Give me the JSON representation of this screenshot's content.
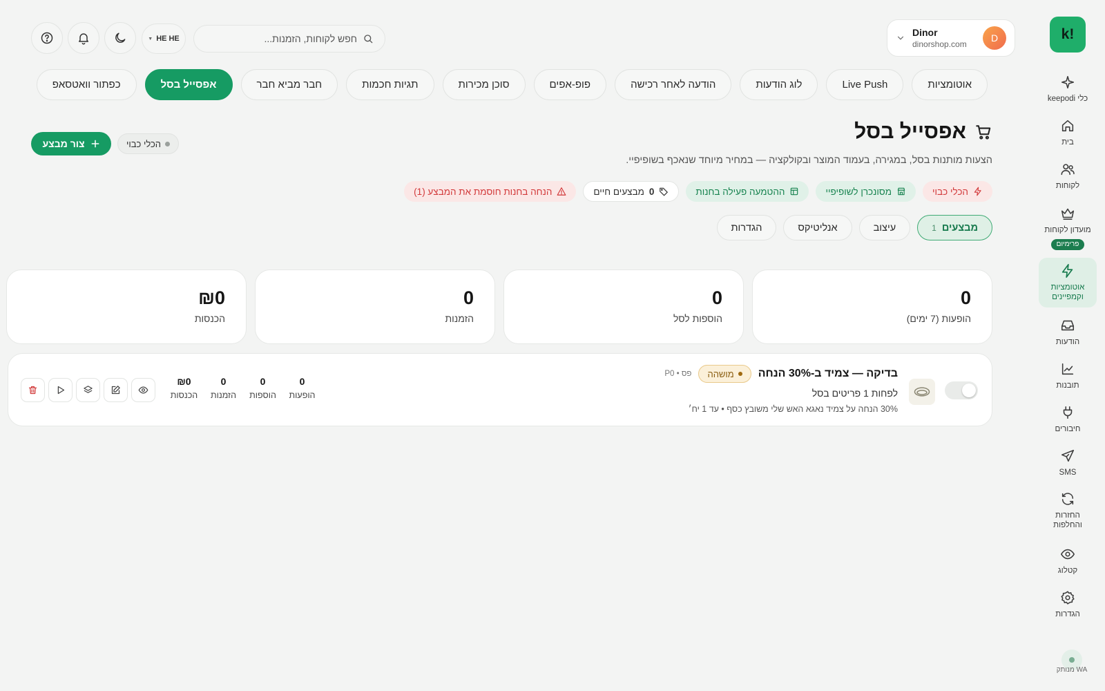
{
  "sidebar": {
    "logo_text": "!k",
    "items": [
      {
        "label": "כלי keepodi",
        "icon": "sparkle-icon"
      },
      {
        "label": "בית",
        "icon": "home-icon"
      },
      {
        "label": "לקוחות",
        "icon": "users-icon"
      },
      {
        "label": "מועדון לקוחות",
        "icon": "crown-icon",
        "badge": "פרימיום"
      },
      {
        "label": "אוטומציות וקמפיינים",
        "icon": "bolt-icon",
        "active": true
      },
      {
        "label": "הודעות",
        "icon": "inbox-icon"
      },
      {
        "label": "תובנות",
        "icon": "chart-icon"
      },
      {
        "label": "חיבורים",
        "icon": "plug-icon"
      },
      {
        "label": "SMS",
        "icon": "send-icon"
      },
      {
        "label": "החזרות והחלפות",
        "icon": "refresh-icon"
      },
      {
        "label": "קטלוג",
        "icon": "eye-icon"
      },
      {
        "label": "הגדרות",
        "icon": "gear-icon"
      }
    ],
    "wa_status": "WA מנותק"
  },
  "header": {
    "store_name": "Dinor",
    "store_domain": "dinorshop.com",
    "avatar_letter": "D",
    "search_placeholder": "חפש לקוחות, הזמנות...",
    "lang_label": "HE"
  },
  "feature_tabs": [
    "אוטומציות",
    "Live Push",
    "לוג הודעות",
    "הודעה לאחר רכישה",
    "פופ-אפים",
    "סוכן מכירות",
    "תגיות חכמות",
    "חבר מביא חבר",
    "אפסייל בסל",
    "כפתור וואטסאפ"
  ],
  "active_feature_tab": "אפסייל בסל",
  "page": {
    "title": "אפסייל בסל",
    "description": "הצעות מותנות בסל, במגירה, בעמוד המוצר ובקולקציה — במחיר מיוחד שנאכף בשופיפיי.",
    "create_button": "צור מבצע",
    "brand_pill": "הכלי כבוי"
  },
  "status_pills": {
    "tool_off": "הכלי כבוי",
    "synced": "מסונכרן לשופיפיי",
    "embed_active": "ההטמעה פעילה בחנות",
    "live_count": "0",
    "live_label": "מבצעים חיים",
    "discount_warning": "הנחה בחנות חוסמת את המבצע (1)"
  },
  "sub_tabs": {
    "offers": "מבצעים",
    "offers_count": "1",
    "design": "עיצוב",
    "analytics": "אנליטיקס",
    "settings": "הגדרות"
  },
  "stats": [
    {
      "value": "0",
      "label": "הופעות (7 ימים)"
    },
    {
      "value": "0",
      "label": "הוספות לסל"
    },
    {
      "value": "0",
      "label": "הזמנות"
    },
    {
      "value": "₪0",
      "label": "הכנסות"
    }
  ],
  "offer": {
    "title": "בדיקה — צמיד ב-30% הנחה",
    "status": "מושהה",
    "priority": "פס • P0",
    "subtitle": "לפחות 1 פריטים בסל",
    "detail": "30% הנחה על צמיד נאגא האש שלי משובץ כסף • עד 1 יח׳",
    "enabled": false,
    "metrics": [
      {
        "value": "0",
        "label": "הופעות"
      },
      {
        "value": "0",
        "label": "הוספות"
      },
      {
        "value": "0",
        "label": "הזמנות"
      },
      {
        "value": "₪0",
        "label": "הכנסות"
      }
    ]
  },
  "colors": {
    "brand_green": "#169b63",
    "danger_red": "#d2393a",
    "paused_amber": "#8a5d10"
  }
}
